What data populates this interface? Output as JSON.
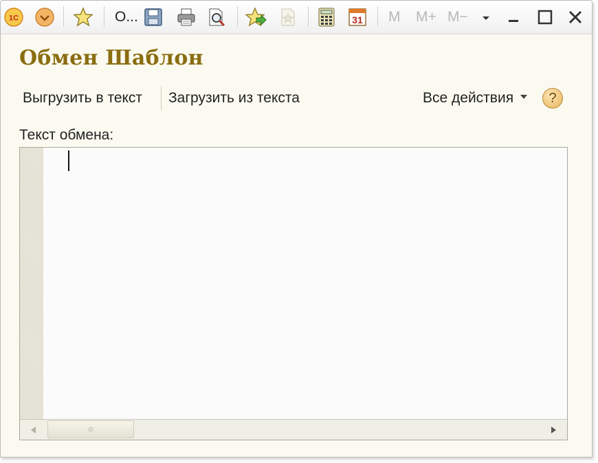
{
  "toolbar": {
    "app_logo": "1С",
    "item_text": "О...",
    "mem_m": "M",
    "mem_plus": "M+",
    "mem_minus": "M−"
  },
  "form": {
    "title": "Обмен Шаблон",
    "commands": {
      "export_label": "Выгрузить в текст",
      "import_label": "Загрузить из текста",
      "all_actions_label": "Все действия",
      "help_label": "?"
    },
    "field_label": "Текст обмена:",
    "field_value": ""
  },
  "colors": {
    "title": "#8a6d10",
    "window_bg": "#fbfaf0",
    "accent_orange": "#e58a1f"
  },
  "icons": [
    "app-logo-icon",
    "menu-dropdown-icon",
    "favorites-star-icon",
    "save-icon",
    "print-icon",
    "print-preview-icon",
    "add-to-favorites-icon",
    "document-icon",
    "calculator-icon",
    "calendar-icon",
    "chevron-down-icon",
    "minimize-icon",
    "maximize-icon",
    "close-icon",
    "scroll-left-icon",
    "scroll-right-icon"
  ],
  "calendar_day": "31"
}
